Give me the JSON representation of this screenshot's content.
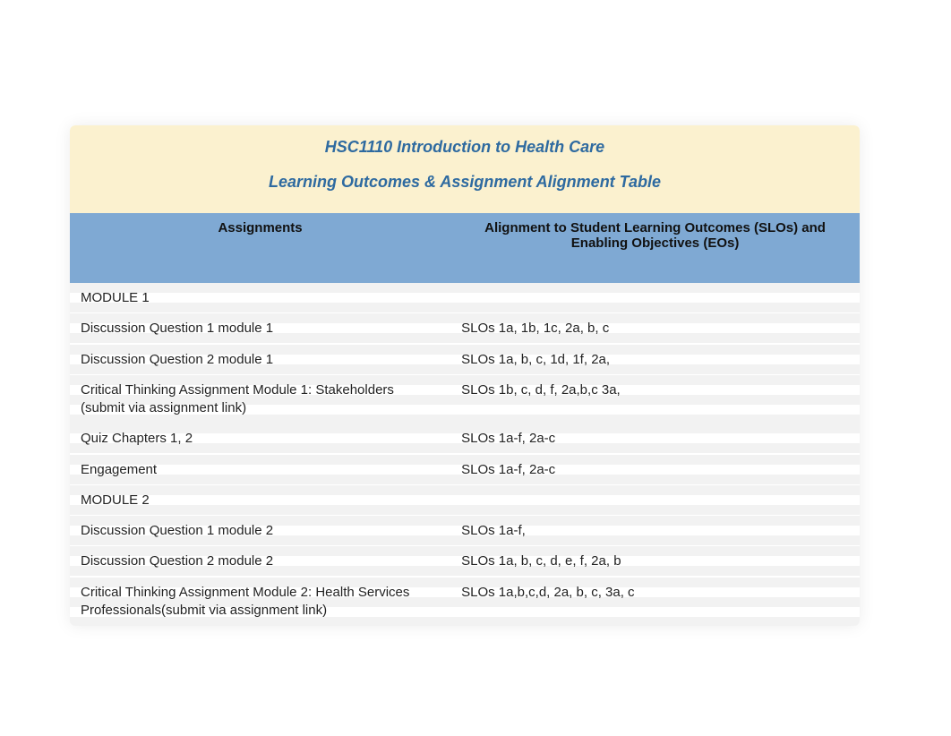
{
  "header": {
    "line1": "HSC1110  Introduction to Health Care",
    "line2": "Learning Outcomes & Assignment Alignment Table "
  },
  "columns": {
    "assignments": "Assignments",
    "alignment": "Alignment to Student Learning Outcomes (SLOs) and Enabling Objectives (EOs)"
  },
  "rows": [
    {
      "assignment": "MODULE 1",
      "alignment": "",
      "module": true
    },
    {
      "assignment": "Discussion Question 1 module 1",
      "alignment": "SLOs 1a, 1b, 1c, 2a, b, c"
    },
    {
      "assignment": "Discussion Question 2 module 1",
      "alignment": "SLOs 1a, b, c, 1d, 1f, 2a,"
    },
    {
      "assignment": "Critical Thinking Assignment Module 1:  Stakeholders  (submit via assignment link)",
      "alignment": "SLOs 1b, c, d, f, 2a,b,c  3a,"
    },
    {
      "assignment": "Quiz Chapters 1, 2",
      "alignment": "SLOs 1a-f, 2a-c"
    },
    {
      "assignment": "Engagement",
      "alignment": "SLOs 1a-f, 2a-c"
    },
    {
      "assignment": "MODULE 2",
      "alignment": "",
      "module": true
    },
    {
      "assignment": "Discussion Question 1 module 2",
      "alignment": "SLOs 1a-f,"
    },
    {
      "assignment": "Discussion Question 2  module 2",
      "alignment": "SLOs 1a, b, c, d, e, f, 2a, b"
    },
    {
      "assignment": "Critical Thinking Assignment Module 2: Health Services Professionals(submit via assignment link)",
      "alignment": "SLOs 1a,b,c,d,  2a, b, c, 3a, c"
    }
  ]
}
